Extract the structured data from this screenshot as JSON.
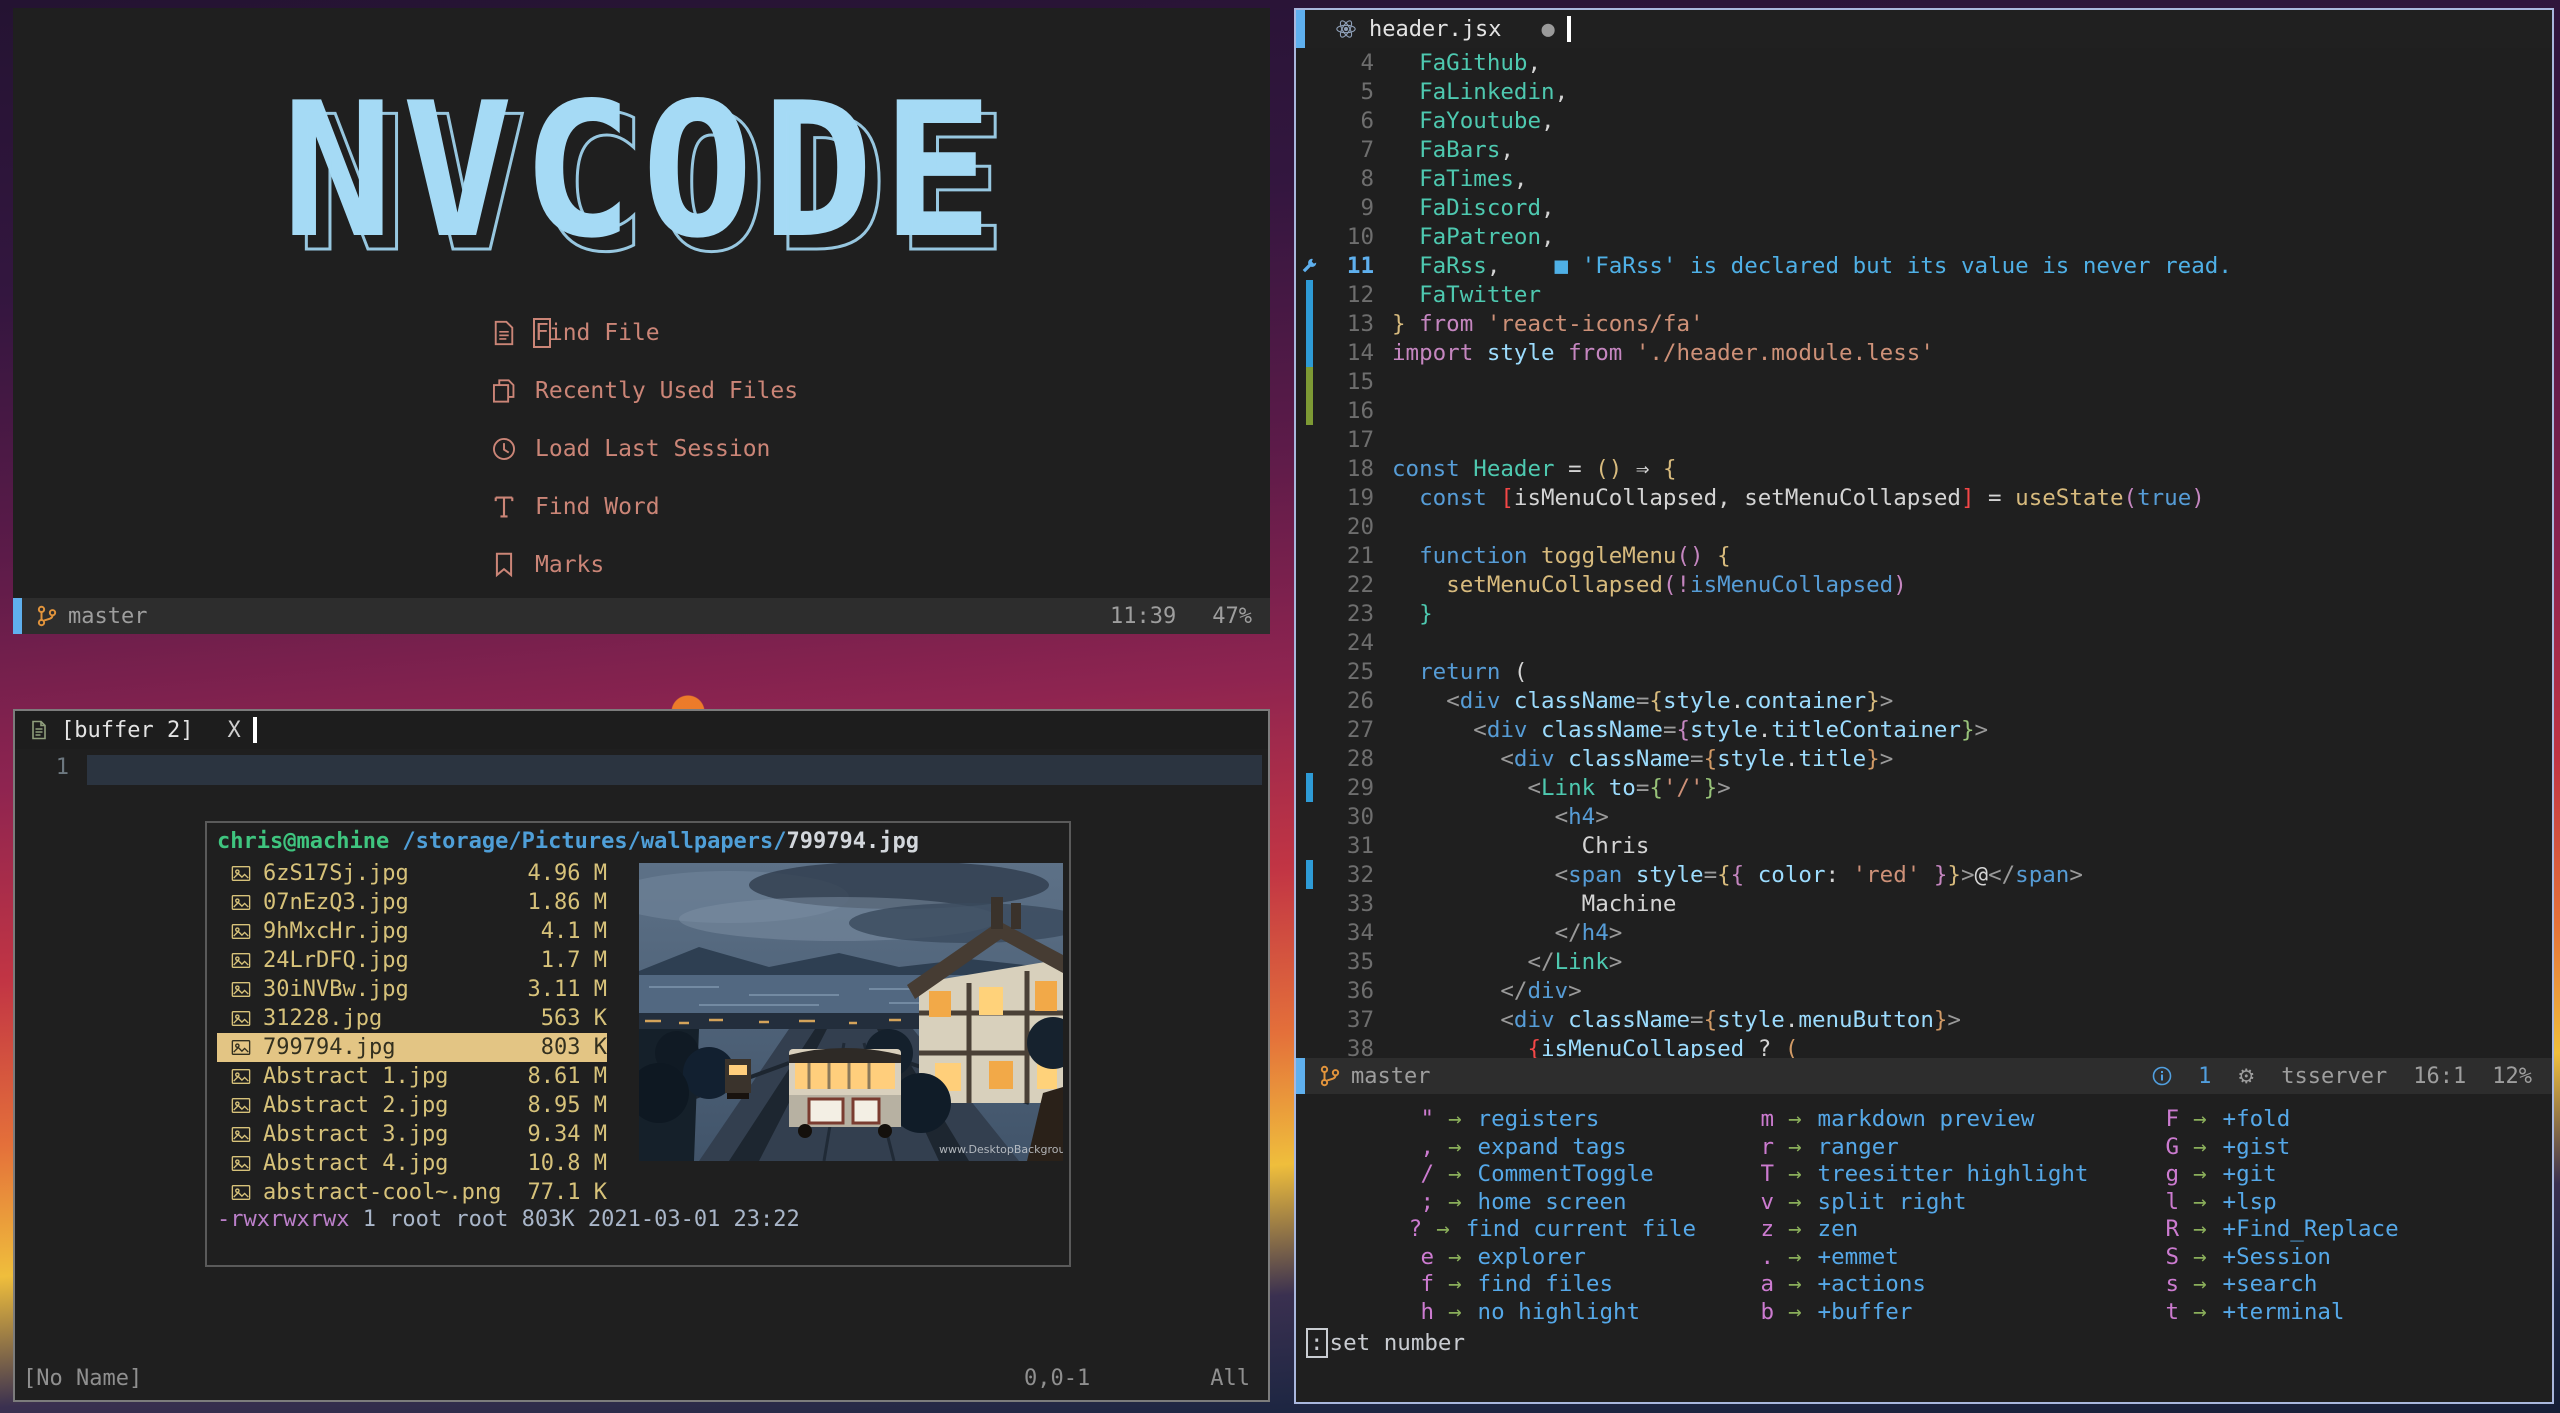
{
  "colors": {
    "accent_blue": "#5fb0ee",
    "salmon": "#cb8577",
    "logo_blue": "#a5daf5",
    "khaki": "#d7c27a",
    "selection_bg": "#e3c584",
    "prompt_green": "#3fc57f",
    "path_blue": "#4f9fd8",
    "perm_purple": "#bb7fc9",
    "branch_orange": "#e2943c",
    "statusline_bg": "#2d2d2d",
    "editor_border": "#a9b7dd",
    "diag_blue": "#4FB0E6"
  },
  "start_window": {
    "logo_text": "NVCODE",
    "menu": [
      {
        "icon": "document-icon",
        "label": "Find File",
        "cursor_on_first": true
      },
      {
        "icon": "copy-icon",
        "label": "Recently Used Files",
        "cursor_on_first": false
      },
      {
        "icon": "clock-icon",
        "label": "Load Last Session",
        "cursor_on_first": false
      },
      {
        "icon": "letter-t-icon",
        "label": "Find Word",
        "cursor_on_first": false
      },
      {
        "icon": "bookmark-icon",
        "label": "Marks",
        "cursor_on_first": false
      }
    ],
    "statusline": {
      "branch": "master",
      "time": "11:39",
      "percent": "47%"
    }
  },
  "buffer_window": {
    "tab": {
      "label": "[buffer 2]",
      "close": "X"
    },
    "line_number": "1",
    "terminal": {
      "prompt_user": "chris@machine",
      "prompt_path": " /storage/Pictures/wallpapers/",
      "prompt_file": "799794.jpg",
      "files": [
        {
          "name": "6zS17Sj.jpg",
          "size": "4.96 M",
          "selected": false
        },
        {
          "name": "07nEzQ3.jpg",
          "size": "1.86 M",
          "selected": false
        },
        {
          "name": "9hMxcHr.jpg",
          "size": "4.1 M",
          "selected": false
        },
        {
          "name": "24LrDFQ.jpg",
          "size": "1.7 M",
          "selected": false
        },
        {
          "name": "30iNVBw.jpg",
          "size": "3.11 M",
          "selected": false
        },
        {
          "name": "31228.jpg",
          "size": "563 K",
          "selected": false
        },
        {
          "name": "799794.jpg",
          "size": "803 K",
          "selected": true
        },
        {
          "name": "Abstract 1.jpg",
          "size": "8.61 M",
          "selected": false
        },
        {
          "name": "Abstract 2.jpg",
          "size": "8.95 M",
          "selected": false
        },
        {
          "name": "Abstract 3.jpg",
          "size": "9.34 M",
          "selected": false
        },
        {
          "name": "Abstract 4.jpg",
          "size": "10.8 M",
          "selected": false
        },
        {
          "name": "abstract-cool~.png",
          "size": "77.1 K",
          "selected": false
        }
      ],
      "perm": "-rwxrwxrwx",
      "perm_rest": " 1 root root 803K 2021-03-01 23:22",
      "image_watermark": "www.DesktopBackground.org"
    },
    "statusline": {
      "left": "[No Name]",
      "pos": "0,0-1",
      "scroll": "All"
    }
  },
  "editor_window": {
    "tab": {
      "name": "header.jsx",
      "modified_dot": "●"
    },
    "code_lines": [
      {
        "n": "4",
        "sign": "",
        "tokens": [
          [
            "t",
            "  FaGithub"
          ],
          [
            "w",
            ","
          ]
        ]
      },
      {
        "n": "5",
        "sign": "",
        "tokens": [
          [
            "t",
            "  FaLinkedin"
          ],
          [
            "w",
            ","
          ]
        ]
      },
      {
        "n": "6",
        "sign": "",
        "tokens": [
          [
            "t",
            "  FaYoutube"
          ],
          [
            "w",
            ","
          ]
        ]
      },
      {
        "n": "7",
        "sign": "",
        "tokens": [
          [
            "t",
            "  FaBars"
          ],
          [
            "w",
            ","
          ]
        ]
      },
      {
        "n": "8",
        "sign": "",
        "tokens": [
          [
            "t",
            "  FaTimes"
          ],
          [
            "w",
            ","
          ]
        ]
      },
      {
        "n": "9",
        "sign": "",
        "tokens": [
          [
            "t",
            "  FaDiscord"
          ],
          [
            "w",
            ","
          ]
        ]
      },
      {
        "n": "10",
        "sign": "",
        "tokens": [
          [
            "t",
            "  FaPatreon"
          ],
          [
            "w",
            ","
          ]
        ]
      },
      {
        "n": "11",
        "sign": "wrench",
        "cursor": true,
        "tokens": [
          [
            "t",
            "  FaRss"
          ],
          [
            "w",
            ","
          ],
          [
            "d",
            "    ■ 'FaRss' is declared but its value is never read."
          ]
        ]
      },
      {
        "n": "12",
        "sign": "bar-blue",
        "tokens": [
          [
            "t",
            "  FaTwitter"
          ]
        ]
      },
      {
        "n": "13",
        "sign": "bar-blue",
        "tokens": [
          [
            "g",
            "}"
          ],
          [
            "w",
            " "
          ],
          [
            "m",
            "from"
          ],
          [
            "w",
            " "
          ],
          [
            "s",
            "'react-icons/fa'"
          ]
        ]
      },
      {
        "n": "14",
        "sign": "bar-blue",
        "tokens": [
          [
            "m",
            "import"
          ],
          [
            "w",
            " "
          ],
          [
            "lb",
            "style"
          ],
          [
            "w",
            " "
          ],
          [
            "m",
            "from"
          ],
          [
            "w",
            " "
          ],
          [
            "s",
            "'./header.module.less'"
          ]
        ]
      },
      {
        "n": "15",
        "sign": "bar-green",
        "tokens": []
      },
      {
        "n": "16",
        "sign": "bar-green",
        "tokens": []
      },
      {
        "n": "17",
        "sign": "",
        "tokens": []
      },
      {
        "n": "18",
        "sign": "",
        "tokens": [
          [
            "b",
            "const"
          ],
          [
            "w",
            " "
          ],
          [
            "t",
            "Header"
          ],
          [
            "w",
            " = "
          ],
          [
            "g",
            "()"
          ],
          [
            "w",
            " ⇒ "
          ],
          [
            "g",
            "{"
          ]
        ]
      },
      {
        "n": "19",
        "sign": "",
        "tokens": [
          [
            "w",
            "  "
          ],
          [
            "b",
            "const"
          ],
          [
            "w",
            " "
          ],
          [
            "r",
            "["
          ],
          [
            "w",
            "isMenuCollapsed"
          ],
          [
            "w",
            ", "
          ],
          [
            "w",
            "setMenuCollapsed"
          ],
          [
            "r",
            "]"
          ],
          [
            "w",
            " = "
          ],
          [
            "g",
            "useState"
          ],
          [
            "m",
            "("
          ],
          [
            "b",
            "true"
          ],
          [
            "m",
            ")"
          ]
        ]
      },
      {
        "n": "20",
        "sign": "",
        "tokens": []
      },
      {
        "n": "21",
        "sign": "",
        "tokens": [
          [
            "w",
            "  "
          ],
          [
            "b",
            "function"
          ],
          [
            "w",
            " "
          ],
          [
            "g",
            "toggleMenu"
          ],
          [
            "m",
            "()"
          ],
          [
            "w",
            " "
          ],
          [
            "g",
            "{"
          ]
        ]
      },
      {
        "n": "22",
        "sign": "",
        "tokens": [
          [
            "w",
            "    "
          ],
          [
            "g",
            "setMenuCollapsed"
          ],
          [
            "m",
            "("
          ],
          [
            "m",
            "!"
          ],
          [
            "b",
            "isMenuCollapsed"
          ],
          [
            "m",
            ")"
          ]
        ]
      },
      {
        "n": "23",
        "sign": "",
        "tokens": [
          [
            "w",
            "  "
          ],
          [
            "t",
            "}"
          ]
        ]
      },
      {
        "n": "24",
        "sign": "",
        "tokens": []
      },
      {
        "n": "25",
        "sign": "",
        "tokens": [
          [
            "w",
            "  "
          ],
          [
            "b",
            "return"
          ],
          [
            "w",
            " ("
          ]
        ]
      },
      {
        "n": "26",
        "sign": "",
        "tokens": [
          [
            "w",
            "    "
          ],
          [
            "gr",
            "<"
          ],
          [
            "b",
            "div"
          ],
          [
            "w",
            " "
          ],
          [
            "lb",
            "className"
          ],
          [
            "gr",
            "="
          ],
          [
            "g",
            "{"
          ],
          [
            "lb",
            "style"
          ],
          [
            "w",
            "."
          ],
          [
            "lb",
            "container"
          ],
          [
            "g",
            "}"
          ],
          [
            "gr",
            ">"
          ]
        ]
      },
      {
        "n": "27",
        "sign": "",
        "tokens": [
          [
            "w",
            "      "
          ],
          [
            "gr",
            "<"
          ],
          [
            "b",
            "div"
          ],
          [
            "w",
            " "
          ],
          [
            "lb",
            "className"
          ],
          [
            "gr",
            "="
          ],
          [
            "m",
            "{"
          ],
          [
            "lb",
            "style"
          ],
          [
            "w",
            "."
          ],
          [
            "lb",
            "titleContainer"
          ],
          [
            "gn",
            "}"
          ],
          [
            "gr",
            ">"
          ]
        ]
      },
      {
        "n": "28",
        "sign": "",
        "tokens": [
          [
            "w",
            "        "
          ],
          [
            "gr",
            "<"
          ],
          [
            "b",
            "div"
          ],
          [
            "w",
            " "
          ],
          [
            "lb",
            "className"
          ],
          [
            "gr",
            "="
          ],
          [
            "o",
            "{"
          ],
          [
            "lb",
            "style"
          ],
          [
            "w",
            "."
          ],
          [
            "lb",
            "title"
          ],
          [
            "o",
            "}"
          ],
          [
            "gr",
            ">"
          ]
        ]
      },
      {
        "n": "29",
        "sign": "bar-blue",
        "tokens": [
          [
            "w",
            "          "
          ],
          [
            "gr",
            "<"
          ],
          [
            "t",
            "Link"
          ],
          [
            "w",
            " "
          ],
          [
            "lb",
            "to"
          ],
          [
            "gr",
            "="
          ],
          [
            "gn",
            "{"
          ],
          [
            "s",
            "'/'"
          ],
          [
            "gn",
            "}"
          ],
          [
            "gr",
            ">"
          ]
        ]
      },
      {
        "n": "30",
        "sign": "",
        "tokens": [
          [
            "w",
            "            "
          ],
          [
            "gr",
            "<"
          ],
          [
            "b",
            "h4"
          ],
          [
            "gr",
            ">"
          ]
        ]
      },
      {
        "n": "31",
        "sign": "",
        "tokens": [
          [
            "w",
            "              Chris"
          ]
        ]
      },
      {
        "n": "32",
        "sign": "bar-blue",
        "tokens": [
          [
            "w",
            "            "
          ],
          [
            "gr",
            "<"
          ],
          [
            "b",
            "span"
          ],
          [
            "w",
            " "
          ],
          [
            "lb",
            "style"
          ],
          [
            "gr",
            "="
          ],
          [
            "g",
            "{"
          ],
          [
            "m",
            "{"
          ],
          [
            "w",
            " "
          ],
          [
            "lb",
            "color"
          ],
          [
            "w",
            ": "
          ],
          [
            "s",
            "'red'"
          ],
          [
            "w",
            " "
          ],
          [
            "m",
            "}"
          ],
          [
            "g",
            "}"
          ],
          [
            "gr",
            ">"
          ],
          [
            "w",
            "@"
          ],
          [
            "gr",
            "</"
          ],
          [
            "b",
            "span"
          ],
          [
            "gr",
            ">"
          ]
        ]
      },
      {
        "n": "33",
        "sign": "",
        "tokens": [
          [
            "w",
            "              Machine"
          ]
        ]
      },
      {
        "n": "34",
        "sign": "",
        "tokens": [
          [
            "w",
            "            "
          ],
          [
            "gr",
            "</"
          ],
          [
            "b",
            "h4"
          ],
          [
            "gr",
            ">"
          ]
        ]
      },
      {
        "n": "35",
        "sign": "",
        "tokens": [
          [
            "w",
            "          "
          ],
          [
            "gr",
            "</"
          ],
          [
            "t",
            "Link"
          ],
          [
            "gr",
            ">"
          ]
        ]
      },
      {
        "n": "36",
        "sign": "",
        "tokens": [
          [
            "w",
            "        "
          ],
          [
            "gr",
            "</"
          ],
          [
            "b",
            "div"
          ],
          [
            "gr",
            ">"
          ]
        ]
      },
      {
        "n": "37",
        "sign": "",
        "tokens": [
          [
            "w",
            "        "
          ],
          [
            "gr",
            "<"
          ],
          [
            "b",
            "div"
          ],
          [
            "w",
            " "
          ],
          [
            "lb",
            "className"
          ],
          [
            "gr",
            "="
          ],
          [
            "o",
            "{"
          ],
          [
            "lb",
            "style"
          ],
          [
            "w",
            "."
          ],
          [
            "lb",
            "menuButton"
          ],
          [
            "o",
            "}"
          ],
          [
            "gr",
            ">"
          ]
        ]
      },
      {
        "n": "38",
        "sign": "",
        "tokens": [
          [
            "w",
            "          "
          ],
          [
            "r",
            "{"
          ],
          [
            "lb",
            "isMenuCollapsed"
          ],
          [
            "w",
            " ? "
          ],
          [
            "o",
            "("
          ]
        ]
      }
    ],
    "statusline": {
      "branch": "master",
      "info_count": "1",
      "gear": "⚙",
      "lsp": "tsserver",
      "pos": "16:1",
      "percent": "12%"
    },
    "whichkey": {
      "columns": [
        [
          {
            "key": "\"",
            "label": "registers"
          },
          {
            "key": ",",
            "label": "expand tags"
          },
          {
            "key": "/",
            "label": "CommentToggle"
          },
          {
            "key": ";",
            "label": "home screen"
          },
          {
            "key": "?",
            "label": "find current file"
          },
          {
            "key": "e",
            "label": "explorer"
          },
          {
            "key": "f",
            "label": "find files"
          },
          {
            "key": "h",
            "label": "no highlight"
          }
        ],
        [
          {
            "key": "m",
            "label": "markdown preview"
          },
          {
            "key": "r",
            "label": "ranger"
          },
          {
            "key": "T",
            "label": "treesitter highlight"
          },
          {
            "key": "v",
            "label": "split right"
          },
          {
            "key": "z",
            "label": "zen"
          },
          {
            "key": ".",
            "label": "+emmet"
          },
          {
            "key": "a",
            "label": "+actions"
          },
          {
            "key": "b",
            "label": "+buffer"
          }
        ],
        [
          {
            "key": "F",
            "label": "+fold"
          },
          {
            "key": "G",
            "label": "+gist"
          },
          {
            "key": "g",
            "label": "+git"
          },
          {
            "key": "l",
            "label": "+lsp"
          },
          {
            "key": "R",
            "label": "+Find_Replace"
          },
          {
            "key": "S",
            "label": "+Session"
          },
          {
            "key": "s",
            "label": "+search"
          },
          {
            "key": "t",
            "label": "+terminal"
          }
        ]
      ],
      "arrow": "→"
    },
    "cmdline": {
      "cursor_char": ":",
      "text": "set number"
    }
  }
}
